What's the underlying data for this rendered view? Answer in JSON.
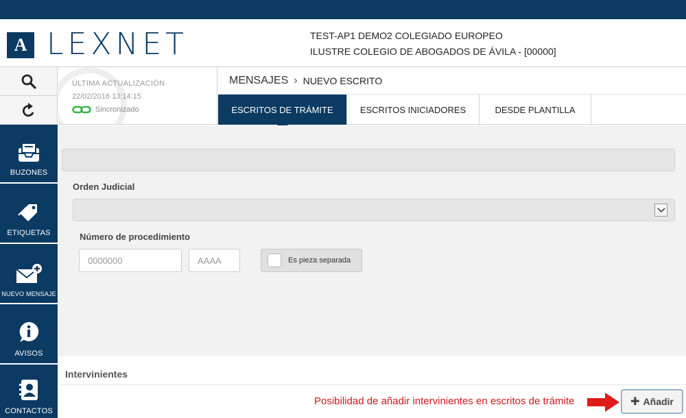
{
  "colors": {
    "brand": "#0b3a63",
    "note": "#d0161b",
    "sync_ok": "#3ab54a"
  },
  "header": {
    "logo_letter": "A",
    "brand": "LEXNET",
    "user_line1": "TEST-AP1 DEMO2 COLEGIADO EUROPEO",
    "user_line2": "ILUSTRE COLEGIO DE ABOGADOS DE ÁVILA - [00000]"
  },
  "tools": {
    "search_icon": "search-icon",
    "refresh_icon": "refresh-icon"
  },
  "sync": {
    "label": "ÚLTIMA ACTUALIZACIÓN",
    "date": "22/02/2016 13:14:15",
    "status": "Sincronizado"
  },
  "breadcrumb": {
    "parent": "MENSAJES",
    "separator": "›",
    "current": "NUEVO ESCRITO"
  },
  "tabs": [
    {
      "label": "ESCRITOS DE TRÁMITE",
      "active": true
    },
    {
      "label": "ESCRITOS INICIADORES",
      "active": false
    },
    {
      "label": "DESDE PLANTILLA",
      "active": false
    }
  ],
  "sidebar": {
    "items": [
      {
        "label": "BUZONES",
        "icon": "inbox-icon"
      },
      {
        "label": "ETIQUETAS",
        "icon": "tags-icon"
      },
      {
        "label": "NUEVO MENSAJE",
        "icon": "new-message-icon"
      },
      {
        "label": "AVISOS",
        "icon": "info-icon"
      },
      {
        "label": "CONTACTOS",
        "icon": "contacts-icon"
      }
    ]
  },
  "form": {
    "orden_label": "Orden Judicial",
    "orden_value": "",
    "numero_label": "Número de procedimiento",
    "numero_placeholder": "0000000",
    "year_placeholder": "AAAA",
    "pieza_label": "Es pieza separada",
    "pieza_checked": false
  },
  "intervinientes": {
    "title": "Intervinientes",
    "note": "Posibilidad de añadir intervinientes en escritos de trámite",
    "add_label": "Añadir",
    "add_icon": "plus-icon"
  }
}
